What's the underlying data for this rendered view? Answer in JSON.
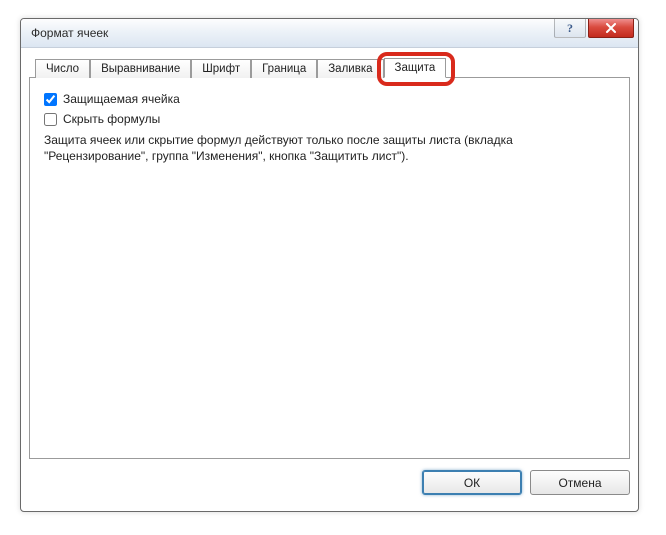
{
  "window": {
    "title": "Формат ячеек",
    "help_symbol": "?"
  },
  "tabs": [
    {
      "label": "Число"
    },
    {
      "label": "Выравнивание"
    },
    {
      "label": "Шрифт"
    },
    {
      "label": "Граница"
    },
    {
      "label": "Заливка"
    },
    {
      "label": "Защита"
    }
  ],
  "protection": {
    "protected_cell_label": "Защищаемая ячейка",
    "hide_formulas_label": "Скрыть формулы",
    "description": "Защита ячеек или скрытие формул действуют только после защиты листа (вкладка \"Рецензирование\", группа \"Изменения\", кнопка \"Защитить лист\")."
  },
  "buttons": {
    "ok": "ОК",
    "cancel": "Отмена"
  }
}
